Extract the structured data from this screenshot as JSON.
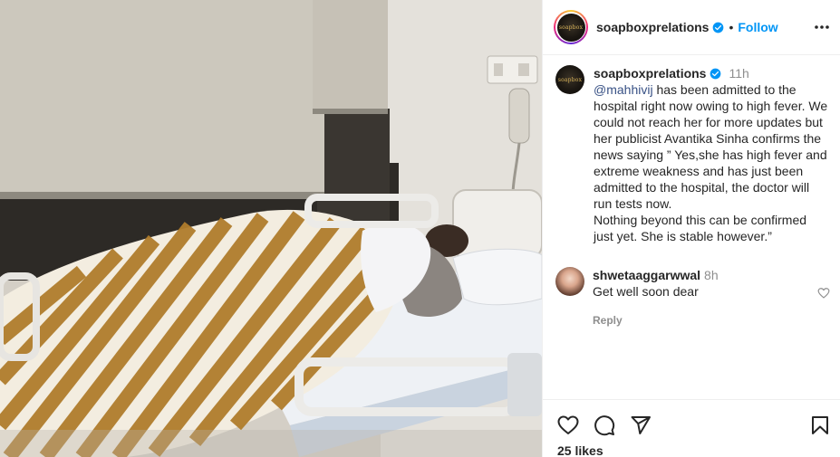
{
  "post": {
    "image_alt": "Hospital room photo",
    "header": {
      "username": "soapboxprelations",
      "separator": "•",
      "follow_label": "Follow"
    },
    "caption": {
      "username": "soapboxprelations",
      "time": "11h",
      "mention": "@mahhivij",
      "text_after_mention": "has been admitted to the hospital right now owing to high fever. We could not reach her for more updates but her publicist Avantika Sinha confirms the news saying ” Yes,she has high fever and extreme weakness and has just been admitted to the hospital, the doctor will run tests now.",
      "text_second": "Nothing beyond this can be confirmed just yet. She is stable however.”"
    },
    "comments": [
      {
        "username": "shwetaaggarwwal",
        "time": "8h",
        "text": "Get well soon dear",
        "reply_label": "Reply"
      }
    ],
    "likes": "25 likes"
  },
  "icons": {
    "verified": "verified-badge-icon",
    "more": "more-options-icon",
    "like": "heart-icon",
    "comment": "comment-icon",
    "share": "share-icon",
    "save": "bookmark-icon",
    "comment_like": "heart-outline-icon"
  },
  "colors": {
    "accent": "#0095f6",
    "verified": "#0095f6",
    "mention": "#385185",
    "muted": "#8e8e8e",
    "text": "#262626",
    "border": "#efefef"
  }
}
